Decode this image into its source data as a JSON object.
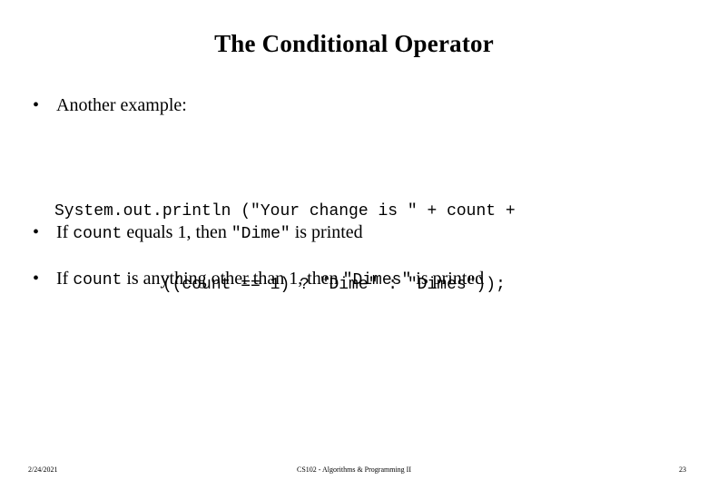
{
  "slide": {
    "title": "The Conditional Operator",
    "bullet_marker": "•",
    "bullets": [
      {
        "id": "bullet-1",
        "segments": [
          {
            "text": "Another example:",
            "mono": false
          }
        ]
      },
      {
        "id": "bullet-2",
        "segments": [
          {
            "text": "If ",
            "mono": false
          },
          {
            "text": "count",
            "mono": true
          },
          {
            "text": " equals 1, then ",
            "mono": false
          },
          {
            "text": "\"Dime\"",
            "mono": true
          },
          {
            "text": " is printed",
            "mono": false
          }
        ]
      },
      {
        "id": "bullet-3",
        "segments": [
          {
            "text": "If ",
            "mono": false
          },
          {
            "text": "count",
            "mono": true
          },
          {
            "text": " is anything other than 1, then ",
            "mono": false
          },
          {
            "text": "\"Dimes\"",
            "mono": true
          },
          {
            "text": " is printed",
            "mono": false
          }
        ]
      }
    ],
    "code_lines": [
      "System.out.println (\"Your change is \" + count +",
      "           ((count == 1) ? \"Dime\" : \"Dimes\"));"
    ],
    "footer": {
      "date": "2/24/2021",
      "course": "CS102 - Algorithms & Programming II",
      "page_number": "23"
    },
    "colors": {
      "background": "#ffffff",
      "text": "#000000"
    }
  }
}
